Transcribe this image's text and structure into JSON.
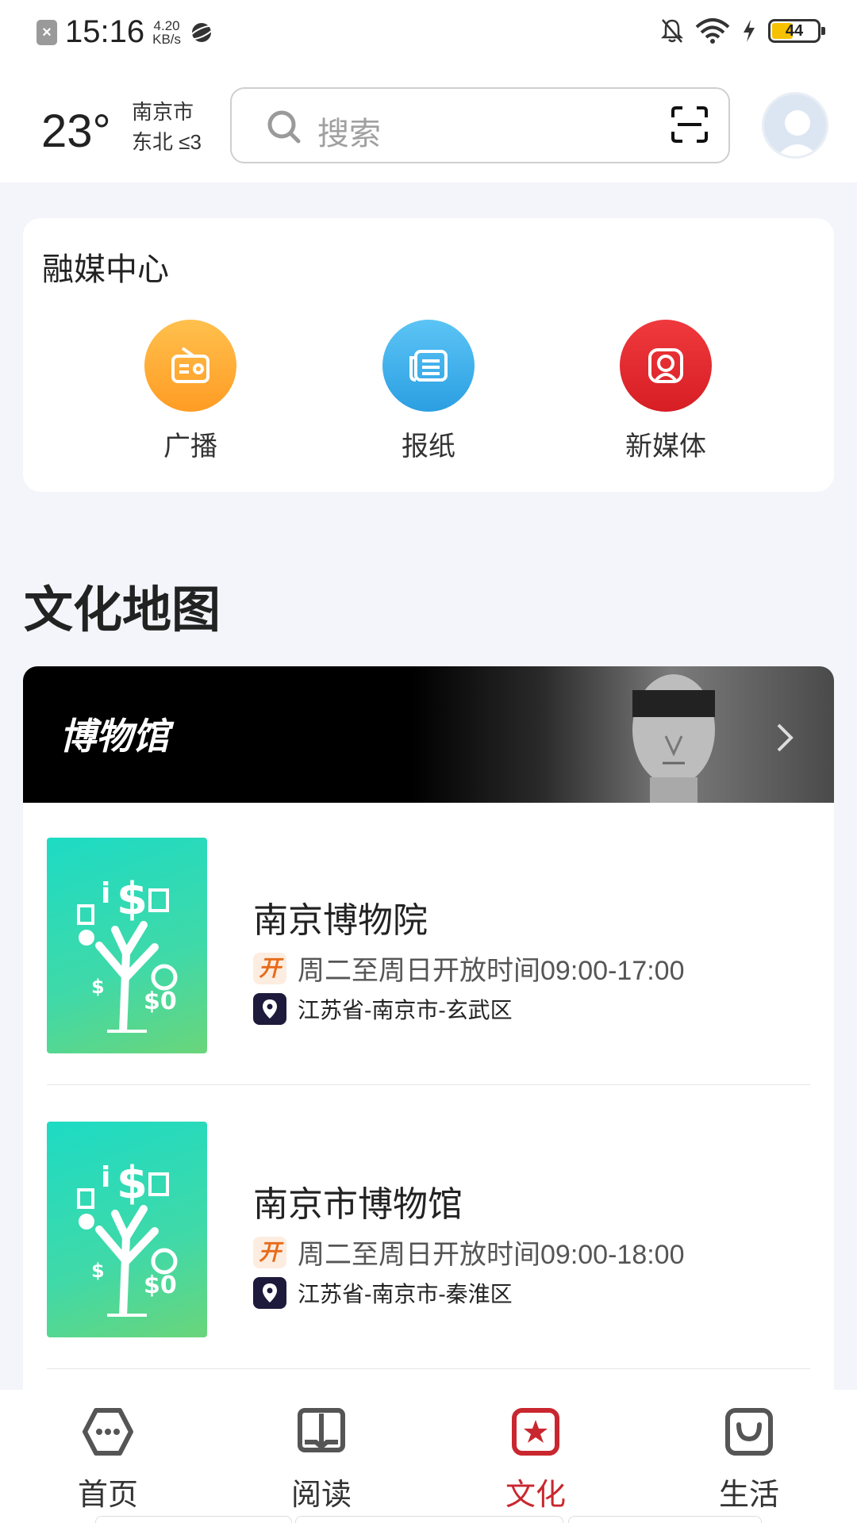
{
  "status_bar": {
    "time": "15:16",
    "net_speed": "4.20",
    "net_unit": "KB/s",
    "battery": "44"
  },
  "header": {
    "temperature": "23°",
    "city": "南京市",
    "wind": "东北 ≤3",
    "search_placeholder": "搜索"
  },
  "media_center": {
    "title": "融媒中心",
    "items": [
      {
        "label": "广播",
        "icon": "radio-icon",
        "color": "#FFA931"
      },
      {
        "label": "报纸",
        "icon": "newspaper-icon",
        "color": "#3AAEEB"
      },
      {
        "label": "新媒体",
        "icon": "new-media-icon",
        "color": "#E0282D"
      }
    ]
  },
  "culture_map": {
    "title": "文化地图",
    "banner_label": "博物馆",
    "museums": [
      {
        "name": "南京博物院",
        "hours": "周二至周日开放时间09:00-17:00",
        "address": "江苏省-南京市-玄武区"
      },
      {
        "name": "南京市博物馆",
        "hours": "周二至周日开放时间09:00-18:00",
        "address": "江苏省-南京市-秦淮区"
      }
    ],
    "open_badge": "开"
  },
  "bottom_nav": {
    "items": [
      {
        "label": "首页",
        "icon": "home-icon"
      },
      {
        "label": "阅读",
        "icon": "book-icon"
      },
      {
        "label": "文化",
        "icon": "culture-star-icon",
        "active": true
      },
      {
        "label": "生活",
        "icon": "life-bag-icon"
      }
    ],
    "active_color": "#C9272F"
  }
}
